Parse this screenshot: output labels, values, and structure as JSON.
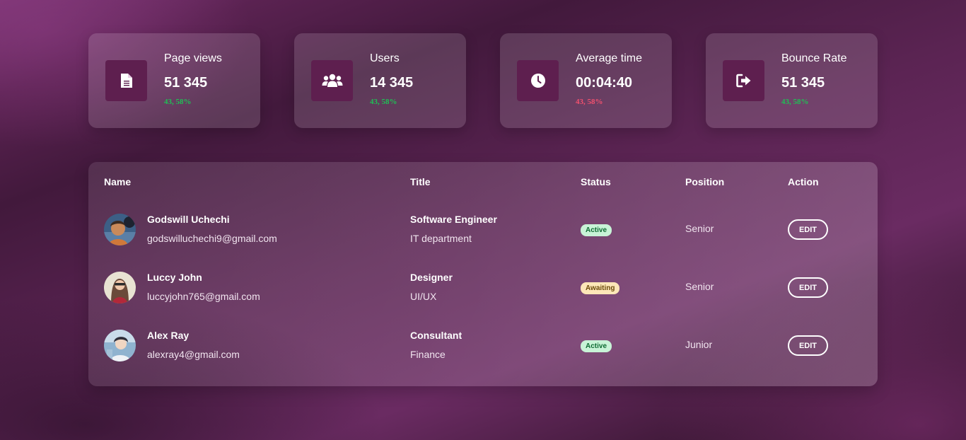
{
  "stats": [
    {
      "label": "Page views",
      "value": "51 345",
      "change": "43, 58%",
      "trend": "up",
      "icon": "document-icon"
    },
    {
      "label": "Users",
      "value": "14 345",
      "change": "43, 58%",
      "trend": "up",
      "icon": "users-icon"
    },
    {
      "label": "Average time",
      "value": "00:04:40",
      "change": "43, 58%",
      "trend": "down",
      "icon": "clock-icon"
    },
    {
      "label": "Bounce Rate",
      "value": "51 345",
      "change": "43, 58%",
      "trend": "up",
      "icon": "sign-out-icon"
    }
  ],
  "table": {
    "headers": {
      "name": "Name",
      "title": "Title",
      "status": "Status",
      "position": "Position",
      "action": "Action"
    },
    "rows": [
      {
        "name": "Godswill Uchechi",
        "email": "godswilluchechi9@gmail.com",
        "job": "Software Engineer",
        "dept": "IT department",
        "status": "Active",
        "position": "Senior",
        "action": "EDIT"
      },
      {
        "name": "Luccy John",
        "email": "luccyjohn765@gmail.com",
        "job": "Designer",
        "dept": "UI/UX",
        "status": "Awaiting",
        "position": "Senior",
        "action": "EDIT"
      },
      {
        "name": "Alex Ray",
        "email": "alexray4@gmail.com",
        "job": "Consultant",
        "dept": "Finance",
        "status": "Active",
        "position": "Junior",
        "action": "EDIT"
      }
    ]
  },
  "colors": {
    "icon_box": "#5e1f4f",
    "trend_up": "#1fbf55",
    "trend_down": "#f0506e",
    "badge_active_bg": "#c8f3d7",
    "badge_awaiting_bg": "#fde7b8"
  }
}
